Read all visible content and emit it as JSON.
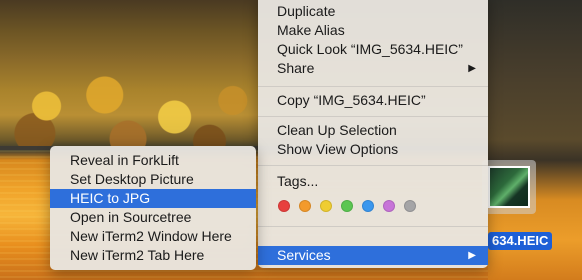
{
  "desktop": {
    "file_name": "634.HEIC"
  },
  "context_menu": {
    "items": [
      {
        "label": "Duplicate"
      },
      {
        "label": "Make Alias"
      },
      {
        "label": "Quick Look “IMG_5634.HEIC”"
      },
      {
        "label": "Share",
        "submenu": true
      },
      {
        "label": "Copy “IMG_5634.HEIC”"
      },
      {
        "label": "Clean Up Selection"
      },
      {
        "label": "Show View Options"
      },
      {
        "label": "Tags..."
      },
      {
        "label": "Services",
        "submenu": true,
        "selected": true
      }
    ],
    "tag_colors": [
      "#e8403e",
      "#f39a2b",
      "#efcd32",
      "#5bc652",
      "#3a97ee",
      "#c774d8",
      "#a5a5a7"
    ]
  },
  "services_menu": {
    "items": [
      {
        "label": "Reveal in ForkLift"
      },
      {
        "label": "Set Desktop Picture"
      },
      {
        "label": "HEIC to JPG",
        "selected": true
      },
      {
        "label": "Open in Sourcetree"
      },
      {
        "label": "New iTerm2 Window Here"
      },
      {
        "label": "New iTerm2 Tab Here"
      }
    ]
  },
  "submenu_arrow": "▶"
}
